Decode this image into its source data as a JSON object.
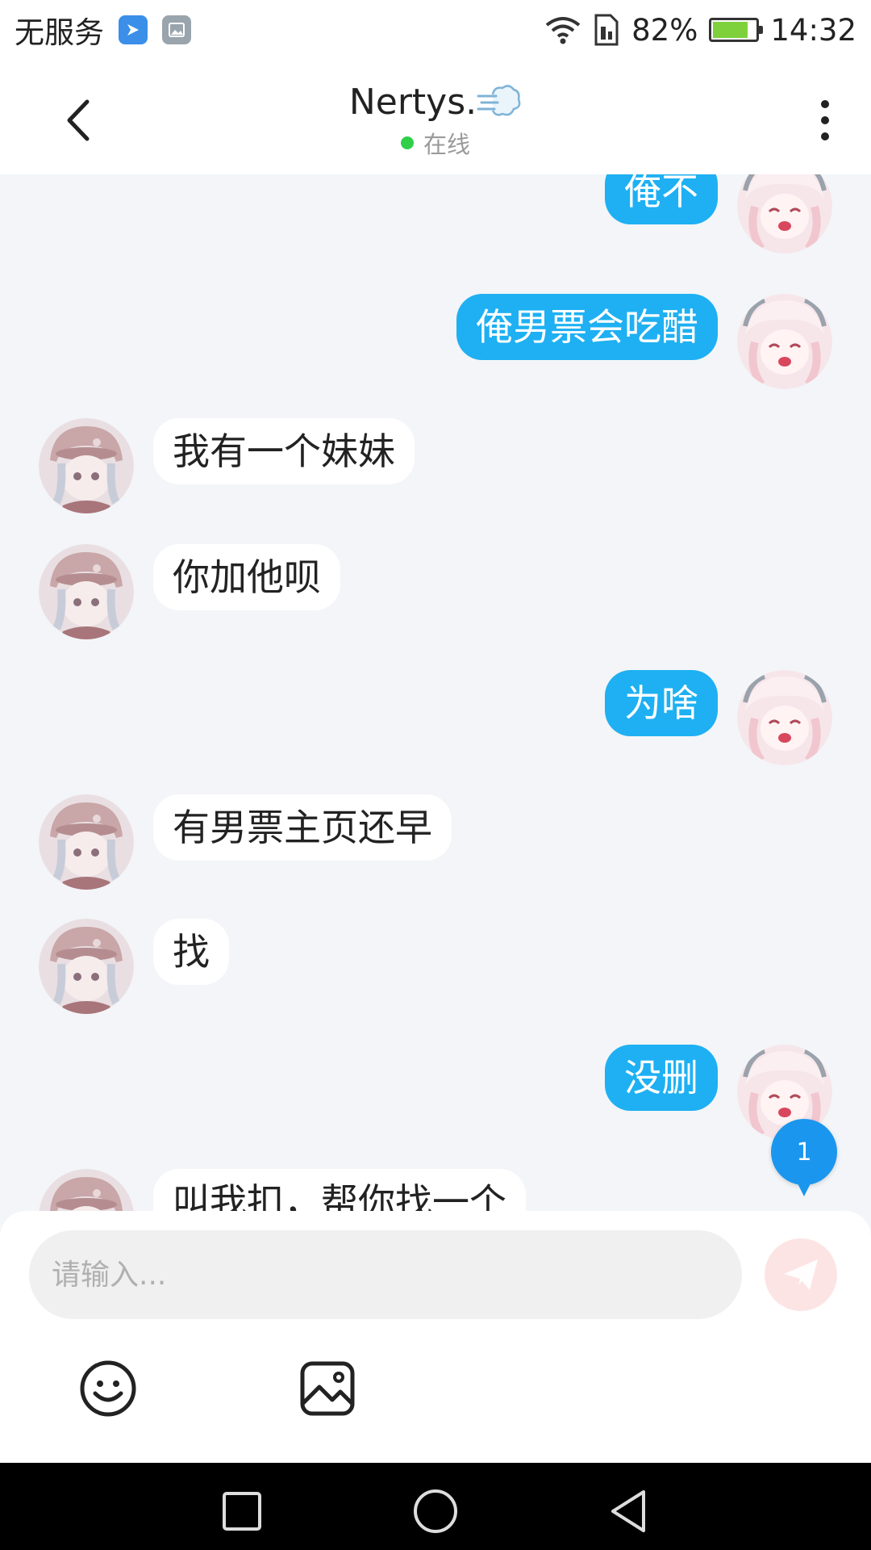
{
  "status_bar": {
    "carrier": "无服务",
    "battery_percent": "82%",
    "battery_level": 0.82,
    "time": "14:32",
    "icons": [
      "app-notify-icon",
      "gallery-notify-icon",
      "wifi-icon",
      "sim-icon",
      "battery-icon"
    ]
  },
  "header": {
    "title": "Nertys.",
    "title_emoji": "dash-cloud-icon",
    "status": "在线",
    "status_color": "#2fcf4a"
  },
  "messages": [
    {
      "side": "right",
      "text": "俺不"
    },
    {
      "side": "right",
      "text": "俺男票会吃醋"
    },
    {
      "side": "left",
      "text": "我有一个妹妹"
    },
    {
      "side": "left",
      "text": "你加他呗"
    },
    {
      "side": "right",
      "text": "为啥"
    },
    {
      "side": "left",
      "text": "有男票主页还早"
    },
    {
      "side": "left",
      "text": "找"
    },
    {
      "side": "right",
      "text": "没删"
    },
    {
      "side": "left",
      "text": "叫我扣，帮你找一个"
    }
  ],
  "unread_badge": "1",
  "input": {
    "placeholder": "请输入..."
  },
  "colors": {
    "accent_blue": "#1eb0f2",
    "background": "#f3f5f8"
  }
}
